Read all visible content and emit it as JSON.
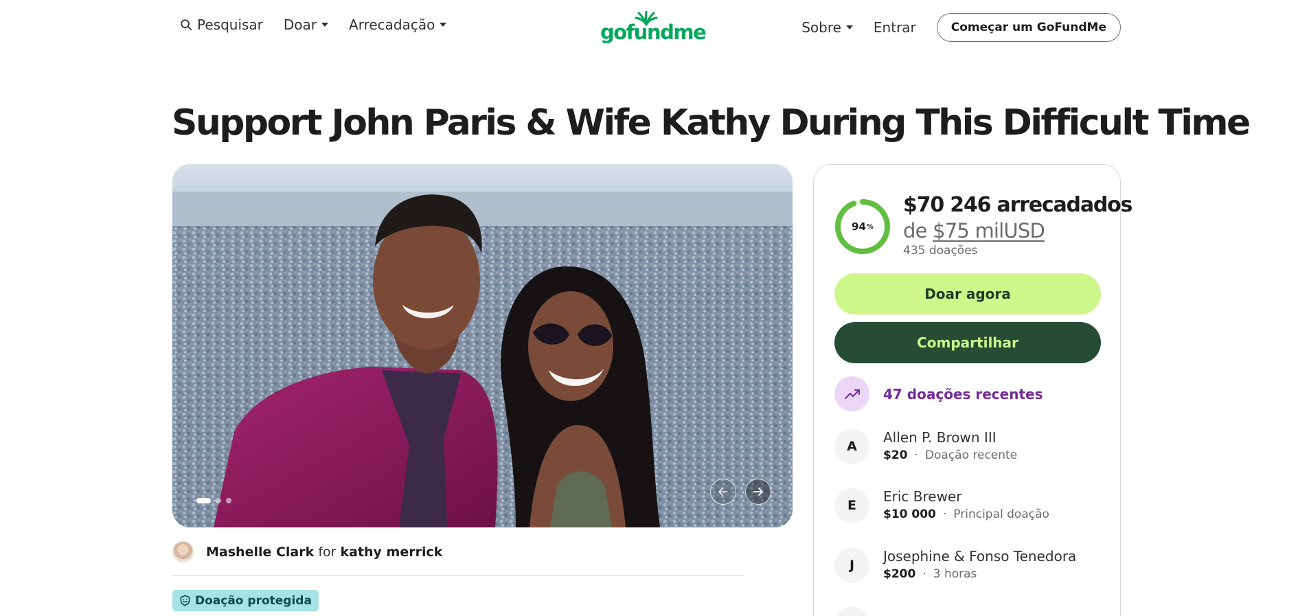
{
  "nav": {
    "search_label": "Pesquisar",
    "donate_label": "Doar",
    "fundraise_label": "Arrecadação",
    "about_label": "Sobre",
    "login_label": "Entrar",
    "start_label": "Começar um GoFundMe"
  },
  "logo": {
    "text": "gofundme",
    "color": "#02a95c"
  },
  "campaign": {
    "title": "Support John Paris & Wife Kathy During This Difficult Time",
    "organizer_name": "Mashelle Clark",
    "for_word": "for",
    "beneficiary": "kathy merrick",
    "protected_label": "Doação protegida",
    "slides": {
      "count": 3,
      "active": 1
    }
  },
  "donation": {
    "progress_percent": 94,
    "progress_label": "94",
    "percent_sign": "%",
    "raised_text": "$70 246 arrecadados",
    "goal_prefix": "de",
    "goal_amount": "$75 milUSD",
    "donations_count_text": "435 doações",
    "donate_button": "Doar agora",
    "share_button": "Compartilhar",
    "recent_label": "47 doações recentes",
    "colors": {
      "ring": "#5fbf3f",
      "donate_bg": "#cdf78b",
      "share_bg": "#264c34",
      "recent": "#74299a"
    }
  },
  "donors": [
    {
      "initial": "A",
      "name": "Allen P. Brown III",
      "amount": "$20",
      "sep": "·",
      "note": "Doação recente"
    },
    {
      "initial": "E",
      "name": "Eric Brewer",
      "amount": "$10 000",
      "sep": "·",
      "note": "Principal doação"
    },
    {
      "initial": "J",
      "name": "Josephine & Fonso Tenedora",
      "amount": "$200",
      "sep": "·",
      "note": "3 horas"
    }
  ]
}
